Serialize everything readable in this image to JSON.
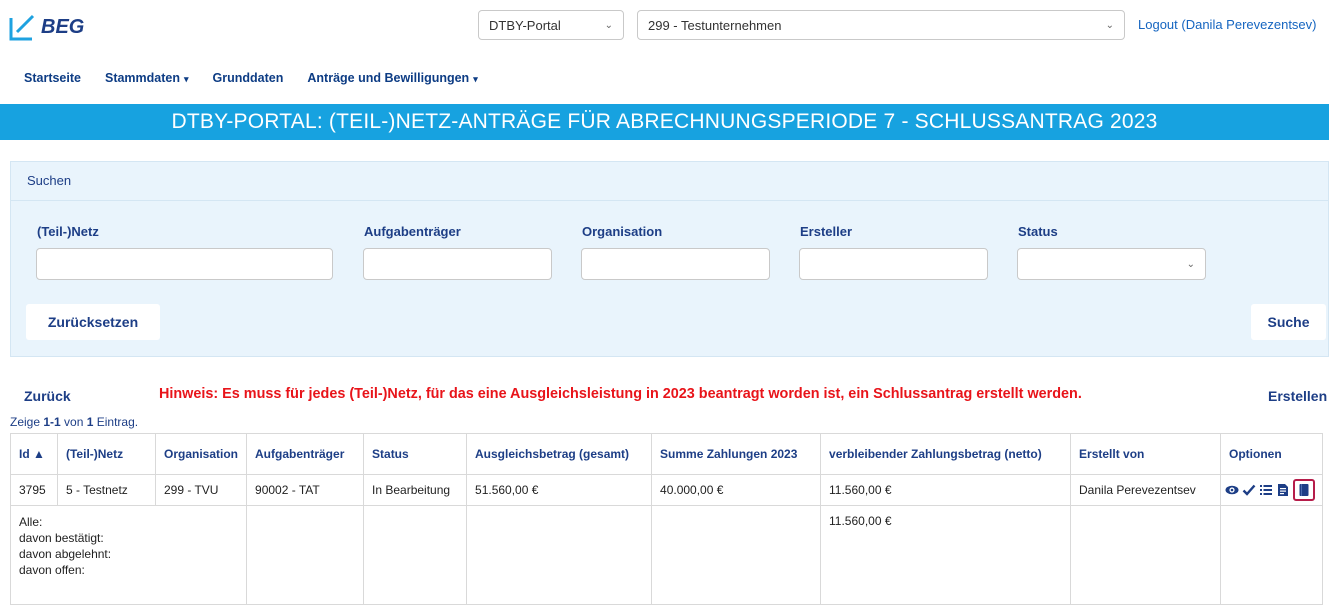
{
  "brand": {
    "name": "BEG"
  },
  "header": {
    "portal_select": "DTBY-Portal",
    "company_select": "299 - Testunternehmen",
    "logout": "Logout (Danila Perevezentsev)"
  },
  "nav": {
    "items": [
      "Startseite",
      "Stammdaten",
      "Grunddaten",
      "Anträge und Bewilligungen"
    ]
  },
  "banner": {
    "title": "DTBY-PORTAL: (TEIL-)NETZ-ANTRÄGE FÜR ABRECHNUNGSPERIODE 7 - SCHLUSSANTRAG 2023"
  },
  "search": {
    "title": "Suchen",
    "labels": [
      "(Teil-)Netz",
      "Aufgabenträger",
      "Organisation",
      "Ersteller",
      "Status"
    ],
    "reset_label": "Zurücksetzen",
    "search_label": "Suche"
  },
  "actions": {
    "back": "Zurück",
    "hint": "Hinweis: Es muss für jedes (Teil-)Netz, für das eine Ausgleichsleistung in 2023 beantragt worden ist, ein Schlussantrag erstellt werden.",
    "create": "Erstellen"
  },
  "summary": {
    "prefix": "Zeige ",
    "range": "1-1",
    "mid": " von ",
    "total": "1",
    "suffix": " Eintrag."
  },
  "table": {
    "columns": [
      "Id",
      "(Teil-)Netz",
      "Organisation",
      "Aufgabenträger",
      "Status",
      "Ausgleichsbetrag (gesamt)",
      "Summe Zahlungen 2023",
      "verbleibender Zahlungsbetrag (netto)",
      "Erstellt von",
      "Optionen"
    ],
    "sort_indicator": "▲",
    "rows": [
      {
        "id": "3795",
        "netz": "5 - Testnetz",
        "organisation": "299 - TVU",
        "aufgabentraeger": "90002 - TAT",
        "status": "In Bearbeitung",
        "ausgleichsbetrag": "51.560,00 €",
        "summe_zahlungen": "40.000,00 €",
        "verbleibend": "11.560,00 €",
        "erstellt_von": "Danila Perevezentsev",
        "option_icons": [
          "eye-icon",
          "check-icon",
          "list-icon",
          "document-icon",
          "book-icon"
        ]
      }
    ],
    "totals": {
      "labels": [
        "Alle:",
        "davon bestätigt:",
        "davon abgelehnt:",
        "davon offen:"
      ],
      "verbleibend": "11.560,00 €"
    }
  },
  "colors": {
    "banner": "#17a2e0",
    "hint": "#e8141a",
    "brand": "#1d3e86",
    "highlight": "#b61d4a"
  }
}
